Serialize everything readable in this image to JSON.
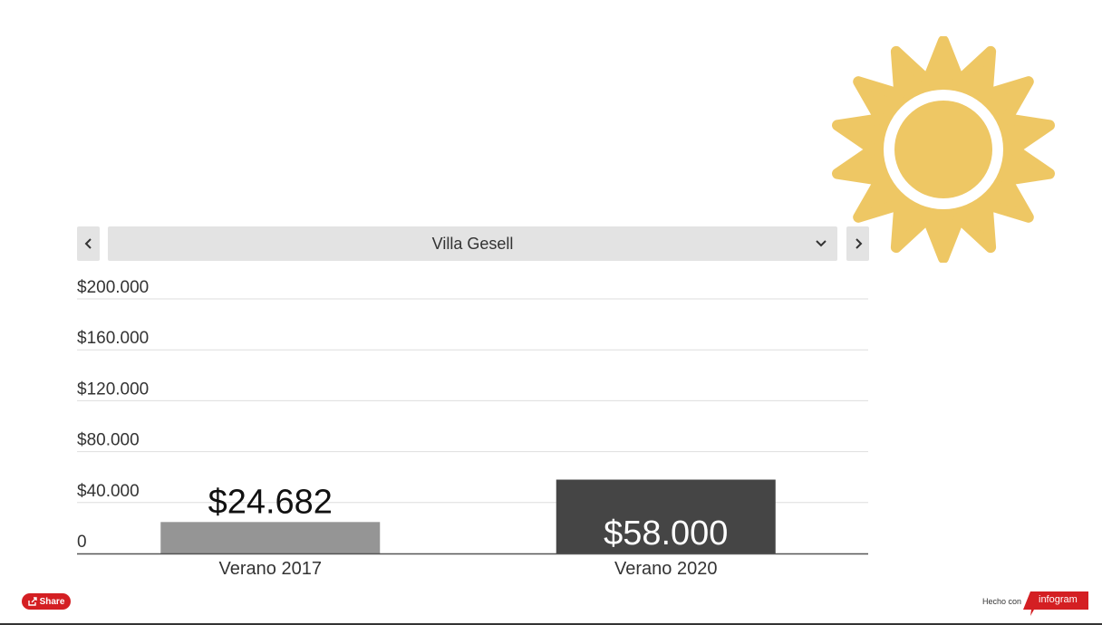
{
  "selector": {
    "current": "Villa Gesell",
    "prev_icon": "chevron-left-icon",
    "next_icon": "chevron-right-icon",
    "dropdown_icon": "chevron-down-icon"
  },
  "decoration": {
    "icon": "sun-icon",
    "color": "#eec764"
  },
  "chart_data": {
    "type": "bar",
    "categories": [
      "Verano 2017",
      "Verano 2020"
    ],
    "values": [
      24682,
      58000
    ],
    "value_labels": [
      "$24.682",
      "$58.000"
    ],
    "bar_colors": [
      "#959595",
      "#454545"
    ],
    "ylim": [
      0,
      200000
    ],
    "yticks": [
      0,
      40000,
      80000,
      120000,
      160000,
      200000
    ],
    "ytick_labels": [
      "0",
      "$40.000",
      "$80.000",
      "$120.000",
      "$160.000",
      "$200.000"
    ],
    "grid": true,
    "title": "",
    "xlabel": "",
    "ylabel": ""
  },
  "footer": {
    "share_label": "Share",
    "made_with": "Hecho con",
    "brand": "infogram",
    "brand_color": "#d41f23"
  }
}
